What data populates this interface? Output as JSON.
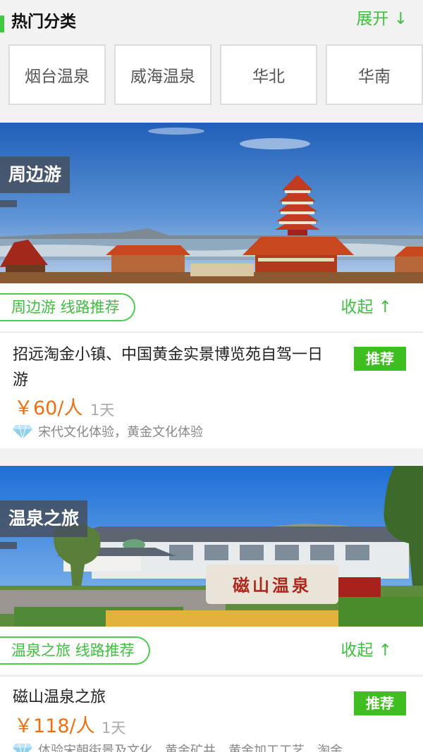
{
  "hot": {
    "title": "热门分类",
    "expand_label": "展开 ↓",
    "categories": [
      "烟台温泉",
      "威海温泉",
      "华北",
      "华南"
    ]
  },
  "sections": [
    {
      "banner_tag": "周边游",
      "pill_label": "周边游 线路推荐",
      "collapse_label": "收起 ↑",
      "route": {
        "title": "招远淘金小镇、中国黄金实景博览苑自驾一日游",
        "badge": "推荐",
        "price": "￥60/人",
        "days": "1天",
        "features": "宋代文化体验，黄金文化体验"
      }
    },
    {
      "banner_tag": "温泉之旅",
      "banner_sign": "磁山温泉",
      "pill_label": "温泉之旅 线路推荐",
      "collapse_label": "收起 ↑",
      "route": {
        "title": "磁山温泉之旅",
        "badge": "推荐",
        "price": "￥118/人",
        "days": "1天",
        "features": "体验宋朝街景及文化，黄金矿井，黄金加工工艺，淘金"
      }
    }
  ],
  "colors": {
    "accent_green": "#3fbf3f",
    "badge_green": "#3fbf1f",
    "price_orange": "#f07010"
  },
  "icons": {
    "feature_icon": "diamond-icon"
  }
}
